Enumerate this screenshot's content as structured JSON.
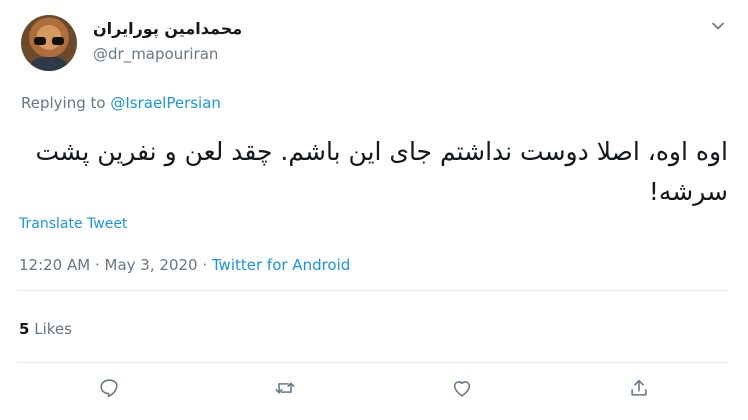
{
  "author": {
    "display_name": "محمدامین پورایران",
    "handle": "@dr_mapouriran"
  },
  "reply": {
    "prefix": "Replying to ",
    "mention": "@IsraelPersian"
  },
  "tweet": {
    "text": "اوه اوه، اصلا دوست نداشتم جای این باشم. چقد لعن و نفرین پشت سرشه!",
    "translate_label": "Translate Tweet",
    "time": "12:20 AM",
    "separator1": " · ",
    "date": "May 3, 2020",
    "separator2": " · ",
    "source": "Twitter for Android"
  },
  "stats": {
    "likes_count": "5",
    "likes_label": " Likes"
  },
  "actions": {
    "reply_icon": "reply-icon",
    "retweet_icon": "retweet-icon",
    "like_icon": "like-icon",
    "share_icon": "share-icon"
  },
  "colors": {
    "link": "#1b95e0",
    "secondary_text": "#657786",
    "primary_text": "#14171a",
    "divider": "#e6ecf0"
  }
}
